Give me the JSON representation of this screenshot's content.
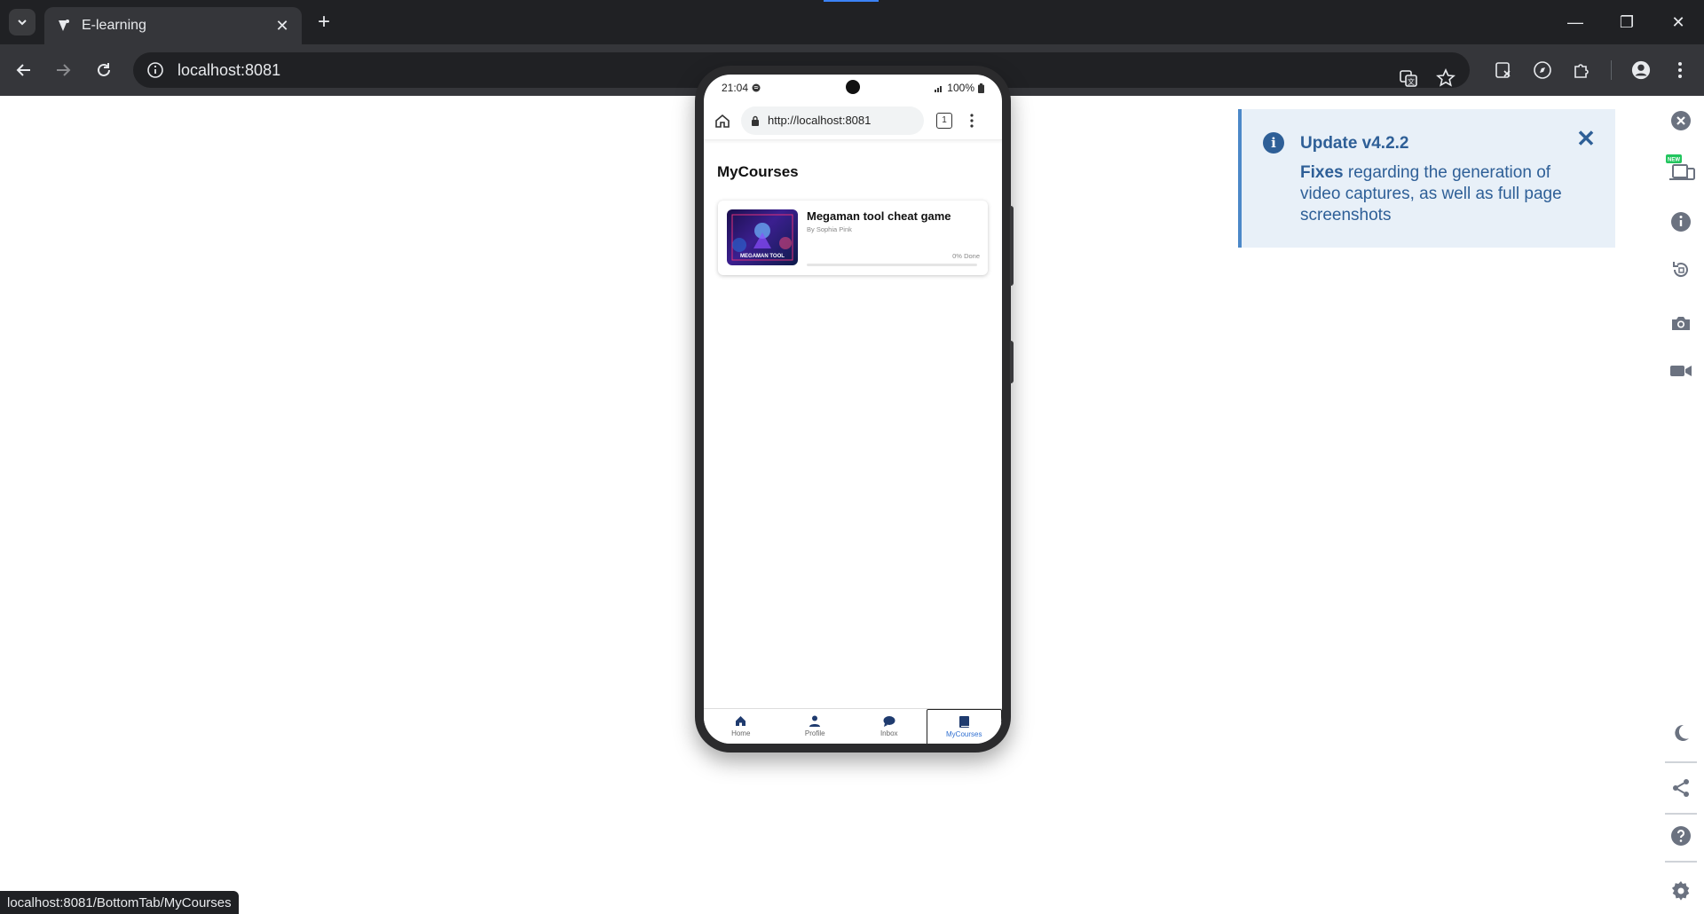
{
  "browser": {
    "tab_title": "E-learning",
    "address": "localhost:8081",
    "status_url": "localhost:8081/BottomTab/MyCourses"
  },
  "phone": {
    "status": {
      "time": "21:04",
      "battery": "100%"
    },
    "url": "http://localhost:8081",
    "tabs_count": "1",
    "heading": "MyCourses",
    "course": {
      "title": "Megaman tool cheat game",
      "author": "By Sophia Pink",
      "progress_label": "0% Done",
      "progress": 0,
      "thumb_text": "MEGAMAN TOOL"
    },
    "bottom_tabs": [
      {
        "label": "Home",
        "icon": "home-icon"
      },
      {
        "label": "Profile",
        "icon": "person-icon"
      },
      {
        "label": "Inbox",
        "icon": "chat-icon"
      },
      {
        "label": "MyCourses",
        "icon": "book-icon",
        "active": true
      }
    ]
  },
  "notice": {
    "title": "Update v4.2.2",
    "body_strong": "Fixes",
    "body_rest": " regarding the generation of video captures, as well as full page screenshots"
  },
  "colors": {
    "accent": "#2f6fd1",
    "notice_bg": "#e8f0f8",
    "notice_text": "#2e5f97",
    "chrome_dark": "#202124"
  }
}
